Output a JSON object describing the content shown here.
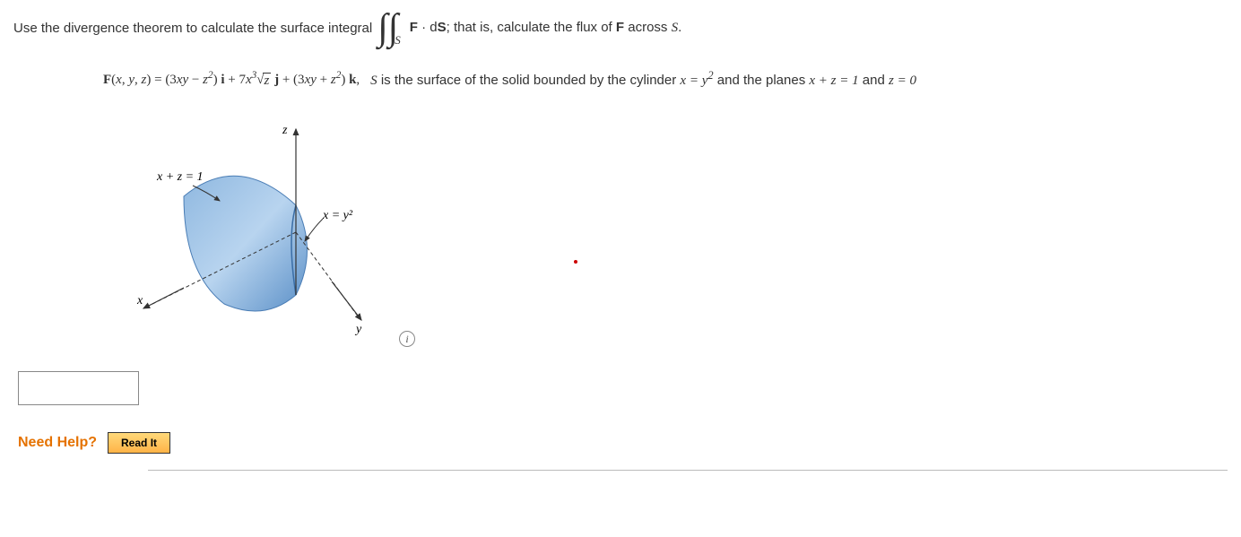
{
  "prompt": {
    "part1": "Use the divergence theorem to calculate the surface integral",
    "integral_sub": "S",
    "part2a": "F",
    "part2b": " · d",
    "part2c": "S",
    "part2d": "; that is, calculate the flux of ",
    "part2e": "F",
    "part2f": " across ",
    "part2g": "S",
    "part2h": "."
  },
  "formula": {
    "lhs": "F(x, y, z) = ",
    "term1a": "(3xy − z",
    "term1b": ") ",
    "i": "i",
    "plus1": " + 7x",
    "sqrt_arg": "z",
    "j": " j",
    "plus2": " + (3xy + z",
    "term3b": ") ",
    "k": "k",
    "comma": ",   "
  },
  "description": {
    "s_part": "S",
    "text1": " is the surface of the solid bounded by the cylinder ",
    "eq1a": "x = y",
    "text2": " and the planes ",
    "eq2": "x + z = ",
    "one": "1",
    "text3": " and ",
    "eq3": "z = ",
    "zero": "0"
  },
  "figure": {
    "z_label": "z",
    "x_label": "x",
    "y_label": "y",
    "plane_label": "x + z = 1",
    "cyl_label": "x = y²"
  },
  "info_icon": "i",
  "help": {
    "label": "Need Help?",
    "read_it": "Read It"
  },
  "sup2": "2",
  "sup3": "3"
}
